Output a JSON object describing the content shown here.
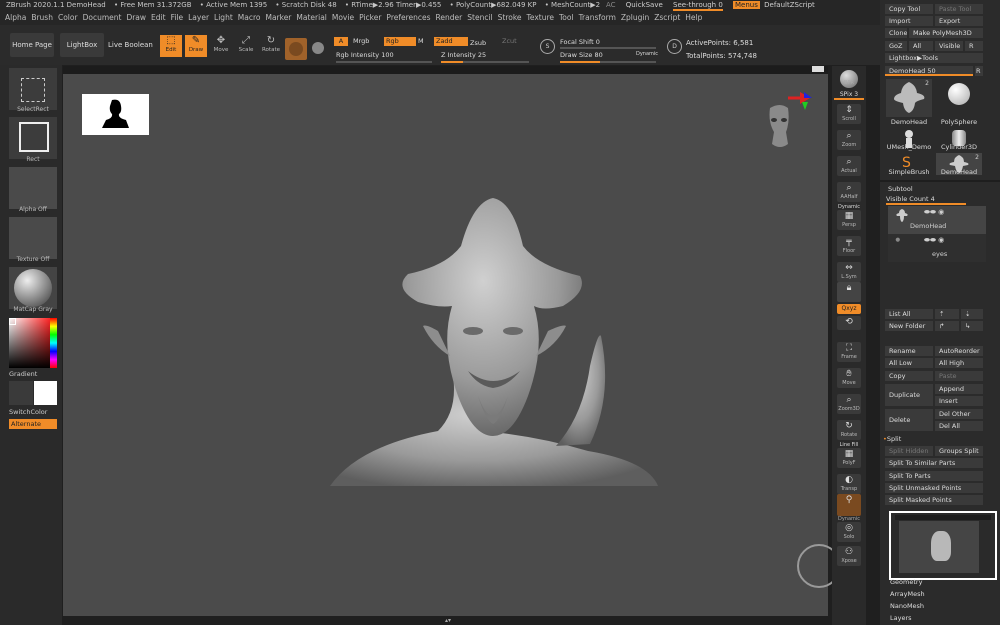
{
  "titlebar": {
    "app": "ZBrush 2020.1.1 DemoHead",
    "free_mem": "• Free Mem 31.372GB",
    "active_mem": "• Active Mem 1395",
    "scratch": "• Scratch Disk 48",
    "rtime": "• RTime▶2.96 Timer▶0.455",
    "polycount": "• PolyCount▶682.049 KP",
    "meshcount": "• MeshCount▶2",
    "ac": "AC",
    "quicksave": "QuickSave",
    "see_through": "See-through 0",
    "menus": "Menus",
    "script": "DefaultZScript"
  },
  "menus": [
    "Alpha",
    "Brush",
    "Color",
    "Document",
    "Draw",
    "Edit",
    "File",
    "Layer",
    "Light",
    "Macro",
    "Marker",
    "Material",
    "Movie",
    "Picker",
    "Preferences",
    "Render",
    "Stencil",
    "Stroke",
    "Texture",
    "Tool",
    "Transform",
    "Zplugin",
    "Zscript",
    "Help"
  ],
  "shelf": {
    "home": "Home Page",
    "lightbox": "LightBox",
    "live_boolean": "Live Boolean",
    "edit": "Edit",
    "draw": "Draw",
    "move": "Move",
    "scale": "Scale",
    "rotate": "Rotate",
    "a": "A",
    "mrgb": "Mrgb",
    "rgb": "Rgb",
    "m": "M",
    "rgb_intensity": "Rgb Intensity 100",
    "zadd": "Zadd",
    "zsub": "Zsub",
    "zcut": "Zcut",
    "z_intensity": "Z Intensity 25",
    "focal_shift": "Focal Shift 0",
    "draw_size": "Draw Size 80",
    "dynamic": "Dynamic",
    "active_points": "ActivePoints: 6,581",
    "total_points": "TotalPoints: 574,748",
    "s_key": "S",
    "d_key": "D"
  },
  "left": {
    "selectrect": "SelectRect",
    "rect": "Rect",
    "alpha_off": "Alpha Off",
    "texture_off": "Texture Off",
    "matcap": "MatCap Gray",
    "gradient": "Gradient",
    "switchcolor": "SwitchColor",
    "alternate": "Alternate"
  },
  "rightstrip": {
    "bpr": "BPR",
    "spix": "SPix 3",
    "scroll": "Scroll",
    "zoom": "Zoom",
    "actual": "Actual",
    "aahalf": "AAHalf",
    "dynamic": "Dynamic",
    "persp": "Persp",
    "floor": "Floor",
    "lsym": "L.Sym",
    "qxyz": "Qxyz",
    "frame": "Frame",
    "move": "Move",
    "zoom3d": "Zoom3D",
    "rotate": "Rotate",
    "linefill": "Line Fill",
    "polyf": "PolyF",
    "transp": "Transp",
    "solo": "Solo",
    "xpose": "Xpose",
    "dynamic2": "Dynamic"
  },
  "palette": {
    "copy_tool": "Copy Tool",
    "paste_tool": "Paste Tool",
    "import": "Import",
    "export": "Export",
    "clone": "Clone",
    "make_polymesh": "Make PolyMesh3D",
    "goz": "GoZ",
    "all": "All",
    "visible": "Visible",
    "r": "R",
    "lightbox_tools": "Lightbox▶Tools",
    "demohead_slider": "DemoHead 50",
    "tools": [
      {
        "label": "DemoHead",
        "badge": "2"
      },
      {
        "label": "PolySphere",
        "badge": ""
      },
      {
        "label": "UMesh_Demo",
        "badge": ""
      },
      {
        "label": "Cylinder3D",
        "badge": ""
      },
      {
        "label": "SimpleBrush",
        "badge": ""
      },
      {
        "label": "DemoHead",
        "badge": "2"
      }
    ],
    "subtool": "Subtool",
    "visible_count": "Visible Count 4",
    "subtools": [
      {
        "label": "DemoHead"
      },
      {
        "label": "eyes"
      }
    ],
    "list_all": "List All",
    "new_folder": "New Folder",
    "rename": "Rename",
    "autoreorder": "AutoReorder",
    "all_low": "All Low",
    "all_high": "All High",
    "copy": "Copy",
    "paste": "Paste",
    "duplicate": "Duplicate",
    "append": "Append",
    "insert": "Insert",
    "delete": "Delete",
    "del_other": "Del Other",
    "del_all": "Del All",
    "split": "Split",
    "split_hidden": "Split Hidden",
    "groups_split": "Groups Split",
    "split_similar": "Split To Similar Parts",
    "split_parts": "Split To Parts",
    "split_unmasked": "Split Unmasked Points",
    "split_masked": "Split Masked Points",
    "geometry": "Geometry",
    "arraymesh": "ArrayMesh",
    "nanomesh": "NanoMesh",
    "layers": "Layers"
  }
}
